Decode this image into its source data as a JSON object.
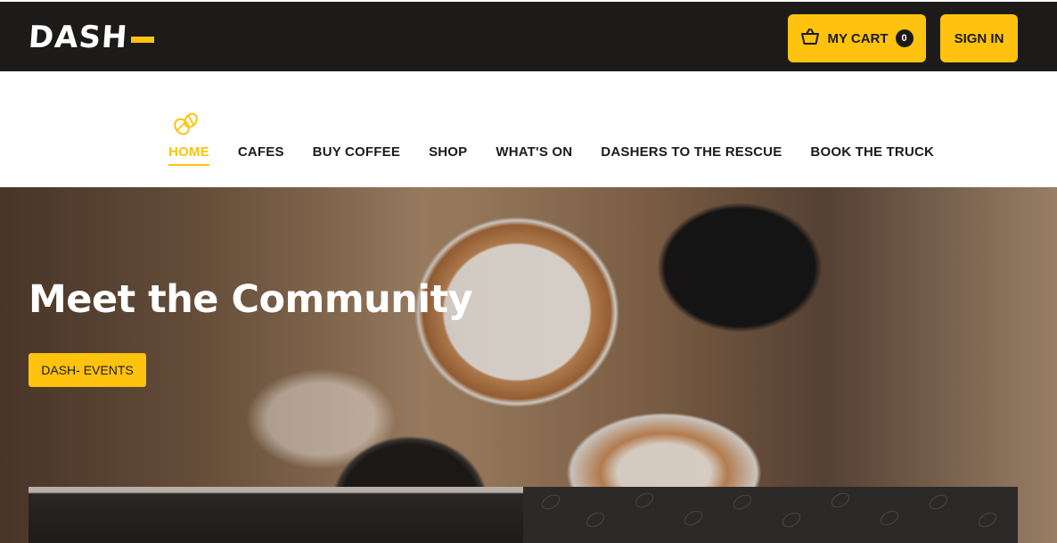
{
  "header": {
    "logo": "DASH",
    "cart_label": "MY CART",
    "cart_count": "0",
    "signin_label": "SIGN IN"
  },
  "nav": {
    "items": [
      {
        "label": "HOME",
        "active": true
      },
      {
        "label": "CAFES",
        "active": false
      },
      {
        "label": "BUY COFFEE",
        "active": false
      },
      {
        "label": "SHOP",
        "active": false
      },
      {
        "label": "WHAT'S ON",
        "active": false
      },
      {
        "label": "DASHERS TO THE RESCUE",
        "active": false
      },
      {
        "label": "BOOK THE TRUCK",
        "active": false
      }
    ]
  },
  "hero": {
    "title": "Meet the Community",
    "button_label": "DASH- EVENTS"
  },
  "colors": {
    "accent": "#ffc20e",
    "dark": "#1c1b1a"
  },
  "icons": [
    "cart-icon",
    "coffee-bean-icon"
  ]
}
